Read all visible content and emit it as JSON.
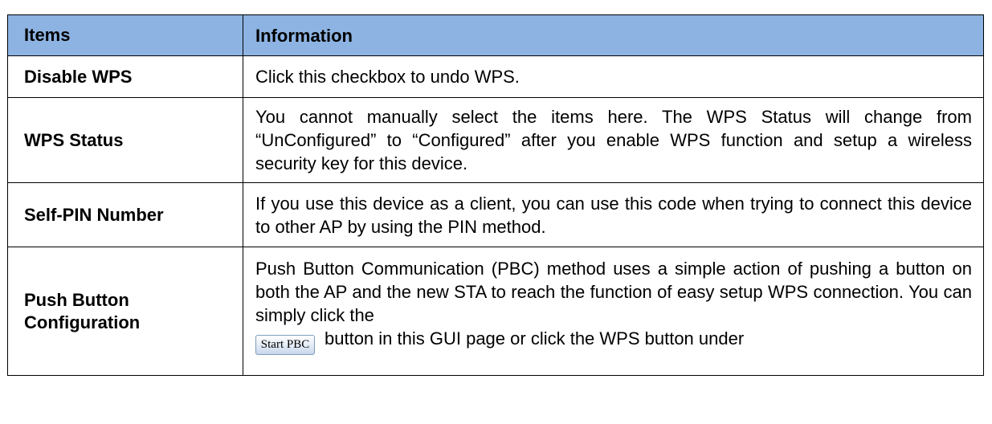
{
  "header": {
    "items": "Items",
    "information": "Information"
  },
  "rows": [
    {
      "item": "Disable WPS",
      "info": "Click this checkbox to undo WPS."
    },
    {
      "item": "WPS Status",
      "info": "You cannot manually select the items here. The WPS Status will change from “UnConfigured” to “Configured” after you enable WPS function and setup a wireless security key for this device."
    },
    {
      "item": "Self-PIN Number",
      "info": "If you use this device as a client, you can use this code when trying to connect this device to other AP by using the PIN method."
    },
    {
      "item_line1": "Push Button",
      "item_line2": "Configuration",
      "info_part1": "Push Button Communication (PBC) method uses a simple action of pushing a button on both the AP and the new STA to reach the function of easy setup WPS connection. You can simply click the",
      "button_label": "Start PBC",
      "info_part2": "button in this GUI page or click the WPS button under"
    }
  ]
}
